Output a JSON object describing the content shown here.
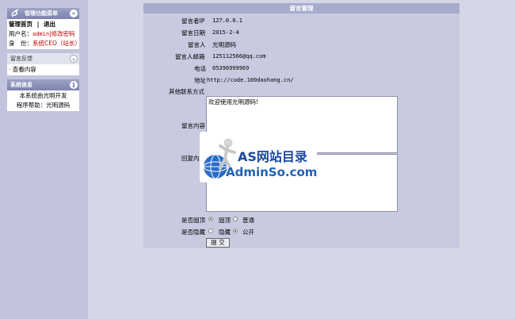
{
  "sidebar": {
    "menu_title": "管理功能菜单",
    "menu_links": {
      "home": "管理首页",
      "separator": "|",
      "logout": "退出"
    },
    "user_label": "用户名：",
    "user_name": "admin",
    "change_password": "|修改密码",
    "identity_label": "身　份：",
    "identity_value": "系统CEO（站长）",
    "feedback_title": "留言反馈",
    "feedback_item": "· 查看内容",
    "sysinfo_title": "系统信息",
    "sysinfo_line1": "本系统由光明开发",
    "sysinfo_line2": "程序帮助：光明源码"
  },
  "form": {
    "title": "留言管理",
    "ip_label": "留言者IP",
    "ip_value": "127.0.0.1",
    "date_label": "留言日期",
    "date_value": "2015-2-4",
    "person_label": "留言人",
    "person_value": "光明源码",
    "email_label": "留言人邮箱",
    "email_value": "125112566@qq.com",
    "phone_label": "电话",
    "phone_value": "05396999969",
    "address_label": "地址",
    "address_value": "http://code.100daohang.cn/",
    "other_contact_label": "其他联系方式",
    "content_label": "留言内容",
    "content_value": "欢迎使用光明源码!",
    "reply_label": "回复内容",
    "reply_value": "",
    "pin_label": "是否固顶",
    "pin_option_top": "固顶",
    "pin_option_normal": "普通",
    "pin_selected": "top",
    "hide_label": "是否隐藏",
    "hide_option_hidden": "隐藏",
    "hide_option_public": "公开",
    "hide_selected": "public",
    "submit_label": "提 交"
  },
  "watermark": {
    "title": "AS网站目录",
    "domain": "AdminSo.com"
  }
}
